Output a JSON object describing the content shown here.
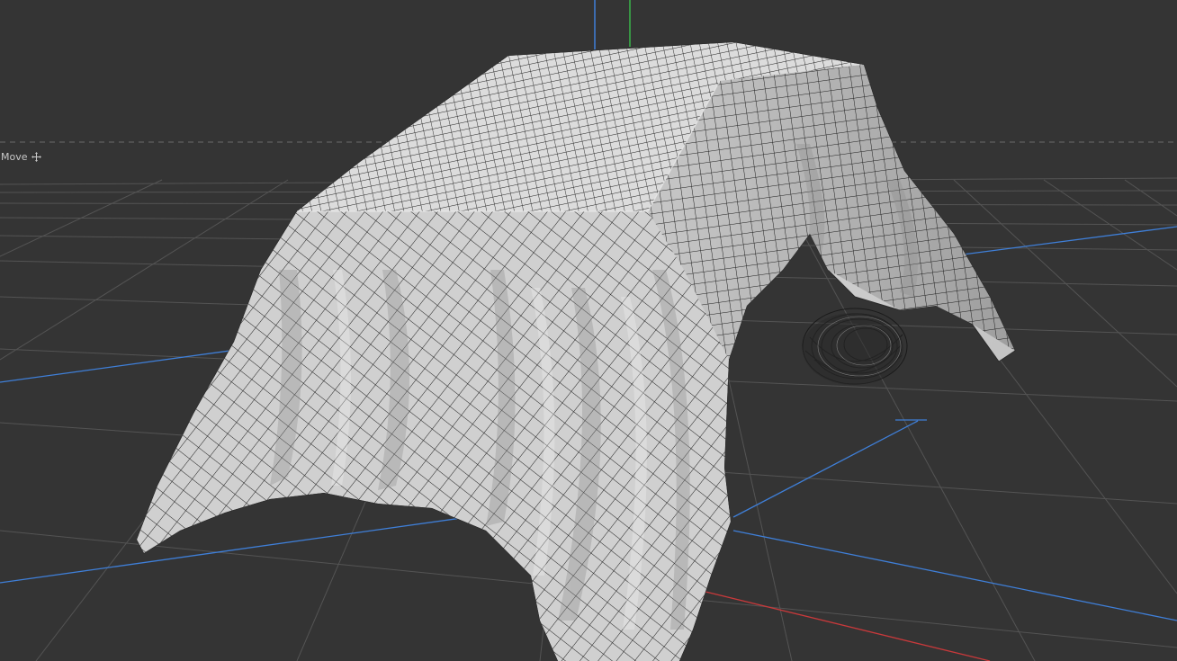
{
  "viewport": {
    "background_color": "#343434",
    "grid_color": "#555555",
    "horizon_line_color": "#6a6a6a",
    "mesh_fill_color": "#d4d4d4",
    "mesh_shade_color": "#a9a9a9",
    "mesh_wire_color": "#1c1c1c",
    "axis_colors": {
      "x": "#c8393b",
      "y": "#39b54a",
      "z": "#3f7fd8"
    }
  },
  "tool": {
    "label": "Move",
    "icon": "move-icon"
  },
  "scene": {
    "object": "cloth-covered-car",
    "visible_parts": [
      "cloth-mesh",
      "wheel-wireframe"
    ]
  }
}
